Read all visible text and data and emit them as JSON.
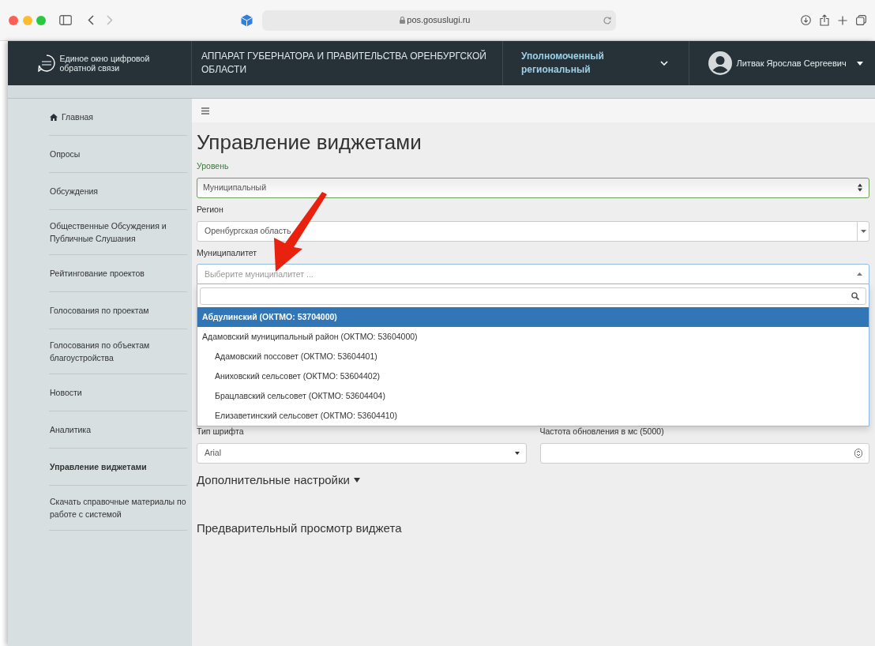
{
  "browser": {
    "address": "pos.gosuslugi.ru"
  },
  "header": {
    "service": "Единое окно цифровой обратной связи",
    "organization": "АППАРАТ ГУБЕРНАТОРА И ПРАВИТЕЛЬСТВА ОРЕНБУРГСКОЙ ОБЛАСТИ",
    "role": "Уполномоченный региональный",
    "user": "Литвак Ярослав Сергеевич"
  },
  "sidebar": {
    "items": [
      {
        "label": "Главная",
        "kind": "home",
        "selected": false
      },
      {
        "label": "Опросы",
        "kind": "link",
        "selected": false
      },
      {
        "label": "Обсуждения",
        "kind": "link",
        "selected": false
      },
      {
        "label": "Общественные Обсуждения и Публичные Слушания",
        "kind": "link",
        "selected": false
      },
      {
        "label": "Рейтингование проектов",
        "kind": "link",
        "selected": false
      },
      {
        "label": "Голосования по проектам",
        "kind": "link",
        "selected": false
      },
      {
        "label": "Голосования по объектам благоустройства",
        "kind": "link",
        "selected": false
      },
      {
        "label": "Новости",
        "kind": "link",
        "selected": false
      },
      {
        "label": "Аналитика",
        "kind": "link",
        "selected": false
      },
      {
        "label": "Управление виджетами",
        "kind": "link",
        "selected": true
      },
      {
        "label": "Скачать справочные материалы по работе с системой",
        "kind": "link",
        "selected": false
      }
    ]
  },
  "page": {
    "title": "Управление виджетами"
  },
  "fields": [
    {
      "label": "Уровень",
      "kind": "native-select",
      "value": "Муниципальный",
      "valid": true
    },
    {
      "label": "Регион",
      "kind": "combo",
      "value": "Оренбургская область",
      "valid": false
    },
    {
      "label": "Муниципалитет",
      "kind": "search-select",
      "placeholder": "Выберите муниципалитет ...",
      "valid": false,
      "expanded": true
    }
  ],
  "dropdown": {
    "options": [
      {
        "label": "Абдулинский (ОКТМО: 53704000)",
        "selected": true
      },
      {
        "label": "Адамовский муниципальный район (ОКТМО: 53604000)",
        "selected": false,
        "children": [
          {
            "label": "Адамовский поссовет (ОКТМО: 53604401)",
            "selected": false
          },
          {
            "label": "Аниховский сельсовет (ОКТМО: 53604402)",
            "selected": false
          },
          {
            "label": "Брацлавский сельсовет (ОКТМО: 53604404)",
            "selected": false
          },
          {
            "label": "Елизаветинский сельсовет (ОКТМО: 53604410)",
            "selected": false
          }
        ]
      }
    ]
  },
  "pair_fields": [
    {
      "label": "Тип шрифта",
      "kind": "select",
      "value": "Arial"
    },
    {
      "label": "Частота обновления в мс (5000)",
      "kind": "number"
    }
  ],
  "sections": [
    {
      "title": "Дополнительные настройки",
      "kind": "toggle",
      "expanded": false
    },
    {
      "title": "Предварительный просмотр виджета",
      "kind": "heading"
    }
  ]
}
